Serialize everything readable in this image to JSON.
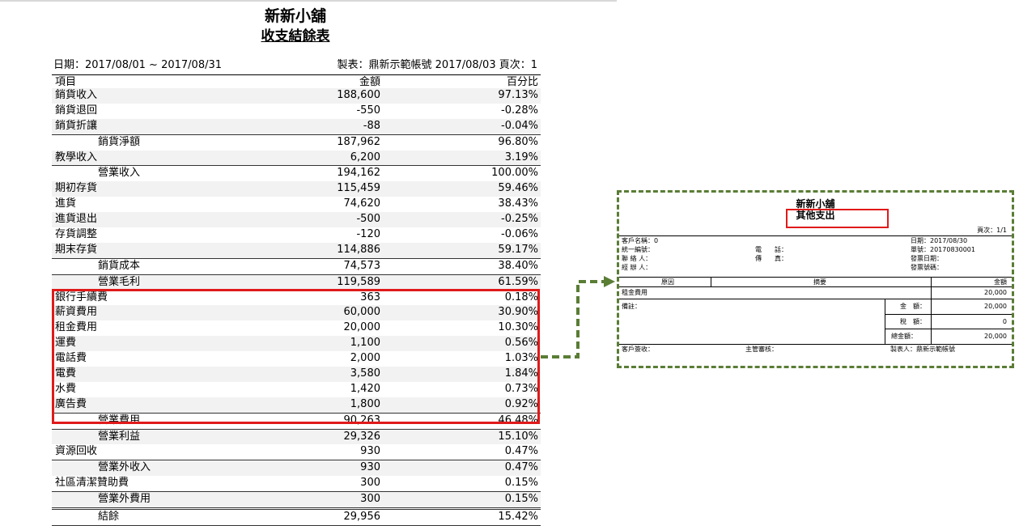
{
  "report": {
    "company": "新新小舖",
    "title": "收支結餘表",
    "date_range": "日期：2017/08/01 ~ 2017/08/31",
    "maker_info": "製表：鼎新示範帳號 2017/08/03 頁次：1",
    "columns": {
      "item": "項目",
      "amount": "金額",
      "percent": "百分比"
    },
    "rows": [
      {
        "name": "銷貨收入",
        "amount": "188,600",
        "pct": "97.13%"
      },
      {
        "name": "銷貨退回",
        "amount": "-550",
        "pct": "-0.28%"
      },
      {
        "name": "銷貨折讓",
        "amount": "-88",
        "pct": "-0.04%"
      },
      {
        "name": "銷貨淨額",
        "amount": "187,962",
        "pct": "96.80%",
        "subtotal": true
      },
      {
        "name": "教學收入",
        "amount": "6,200",
        "pct": "3.19%"
      },
      {
        "name": "營業收入",
        "amount": "194,162",
        "pct": "100.00%",
        "subtotal": true
      },
      {
        "name": "期初存貨",
        "amount": "115,459",
        "pct": "59.46%"
      },
      {
        "name": "進貨",
        "amount": "74,620",
        "pct": "38.43%"
      },
      {
        "name": "進貨退出",
        "amount": "-500",
        "pct": "-0.25%"
      },
      {
        "name": "存貨調整",
        "amount": "-120",
        "pct": "-0.06%"
      },
      {
        "name": "期末存貨",
        "amount": "114,886",
        "pct": "59.17%"
      },
      {
        "name": "銷貨成本",
        "amount": "74,573",
        "pct": "38.40%",
        "subtotal": true
      },
      {
        "name": "營業毛利",
        "amount": "119,589",
        "pct": "61.59%",
        "subtotal": true
      },
      {
        "name": "銀行手續費",
        "amount": "363",
        "pct": "0.18%"
      },
      {
        "name": "薪資費用",
        "amount": "60,000",
        "pct": "30.90%"
      },
      {
        "name": "租金費用",
        "amount": "20,000",
        "pct": "10.30%"
      },
      {
        "name": "運費",
        "amount": "1,100",
        "pct": "0.56%"
      },
      {
        "name": "電話費",
        "amount": "2,000",
        "pct": "1.03%"
      },
      {
        "name": "電費",
        "amount": "3,580",
        "pct": "1.84%"
      },
      {
        "name": "水費",
        "amount": "1,420",
        "pct": "0.73%"
      },
      {
        "name": "廣告費",
        "amount": "1,800",
        "pct": "0.92%"
      },
      {
        "name": "營業費用",
        "amount": "90,263",
        "pct": "46.48%",
        "subtotal": true
      },
      {
        "name": "營業利益",
        "amount": "29,326",
        "pct": "15.10%",
        "subtotal": true
      },
      {
        "name": "資源回收",
        "amount": "930",
        "pct": "0.47%"
      },
      {
        "name": "營業外收入",
        "amount": "930",
        "pct": "0.47%",
        "subtotal": true
      },
      {
        "name": "社區清潔贊助費",
        "amount": "300",
        "pct": "0.15%"
      },
      {
        "name": "營業外費用",
        "amount": "300",
        "pct": "0.15%",
        "subtotal": true
      },
      {
        "name": "結餘",
        "amount": "29,956",
        "pct": "15.42%",
        "final": true
      }
    ]
  },
  "voucher": {
    "company": "新新小舖",
    "title": "其他支出",
    "page": "頁次：1/1",
    "customer_name": "客戶名稱：0",
    "tax_id": "統一編號：",
    "contact": "聯 絡 人：",
    "handler": "經 辦 人：",
    "phone": "電　　話：",
    "fax": "傳　　真：",
    "date": "日期：2017/08/30",
    "doc_no": "單號：20170830001",
    "invoice_date": "發票日期：",
    "invoice_no": "發票號碼：",
    "col_reason": "原因",
    "col_summary": "摘要",
    "col_amount": "金額",
    "line_item": "租金費用",
    "line_amount": "20,000",
    "remarks": "備註：",
    "amount_label": "金　額：",
    "amount_value": "20,000",
    "tax_label": "稅　額：",
    "tax_value": "0",
    "total_label": "總金額：",
    "total_value": "20,000",
    "sign_customer": "客戶簽收：",
    "sign_manager": "主管審核：",
    "sign_maker": "製表人：鼎新示範帳號"
  },
  "colors": {
    "highlight": "#e01a1a",
    "connector": "#5a7d35"
  }
}
